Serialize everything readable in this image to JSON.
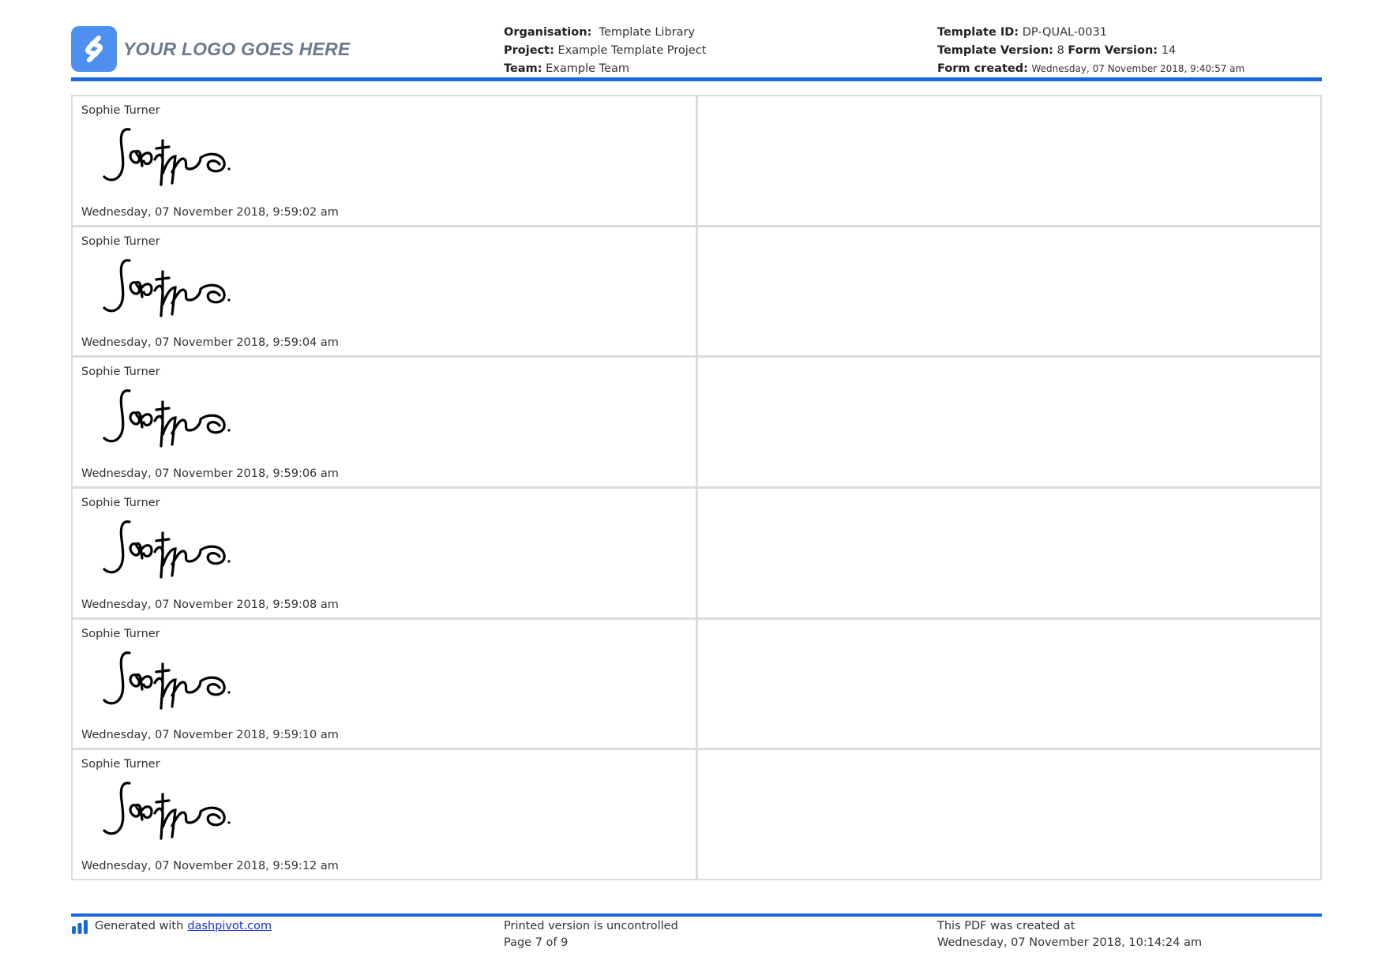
{
  "header": {
    "logo_text": "YOUR LOGO GOES HERE",
    "logo_icon": "logo-s-icon",
    "organisation_label": "Organisation:",
    "organisation_value": "Template Library",
    "project_label": "Project:",
    "project_value": "Example Template Project",
    "team_label": "Team:",
    "team_value": "Example Team",
    "template_id_label": "Template ID:",
    "template_id_value": "DP-QUAL-0031",
    "template_version_label": "Template Version:",
    "template_version_value": "8",
    "form_version_label": "Form Version:",
    "form_version_value": "14",
    "form_created_label": "Form created:",
    "form_created_value": "Wednesday, 07 November 2018, 9:40:57 am"
  },
  "signatures": [
    {
      "name": "Sophie Turner",
      "date": "Wednesday, 07 November 2018, 9:59:02 am"
    },
    {
      "name": "Sophie Turner",
      "date": "Wednesday, 07 November 2018, 9:59:04 am"
    },
    {
      "name": "Sophie Turner",
      "date": "Wednesday, 07 November 2018, 9:59:06 am"
    },
    {
      "name": "Sophie Turner",
      "date": "Wednesday, 07 November 2018, 9:59:08 am"
    },
    {
      "name": "Sophie Turner",
      "date": "Wednesday, 07 November 2018, 9:59:10 am"
    },
    {
      "name": "Sophie Turner",
      "date": "Wednesday, 07 November 2018, 9:59:12 am"
    }
  ],
  "footer": {
    "generated_text": "Generated with",
    "generated_link": "dashpivot.com",
    "uncontrolled_text": "Printed version is uncontrolled",
    "page_text": "Page 7 of 9",
    "created_label": "This PDF was created at",
    "created_value": "Wednesday, 07 November 2018, 10:14:24 am"
  },
  "colors": {
    "accent": "#1a68d8",
    "logo_bg": "#4d90f0",
    "link": "#1a2fd0",
    "grid_border": "#dcdcdc"
  }
}
